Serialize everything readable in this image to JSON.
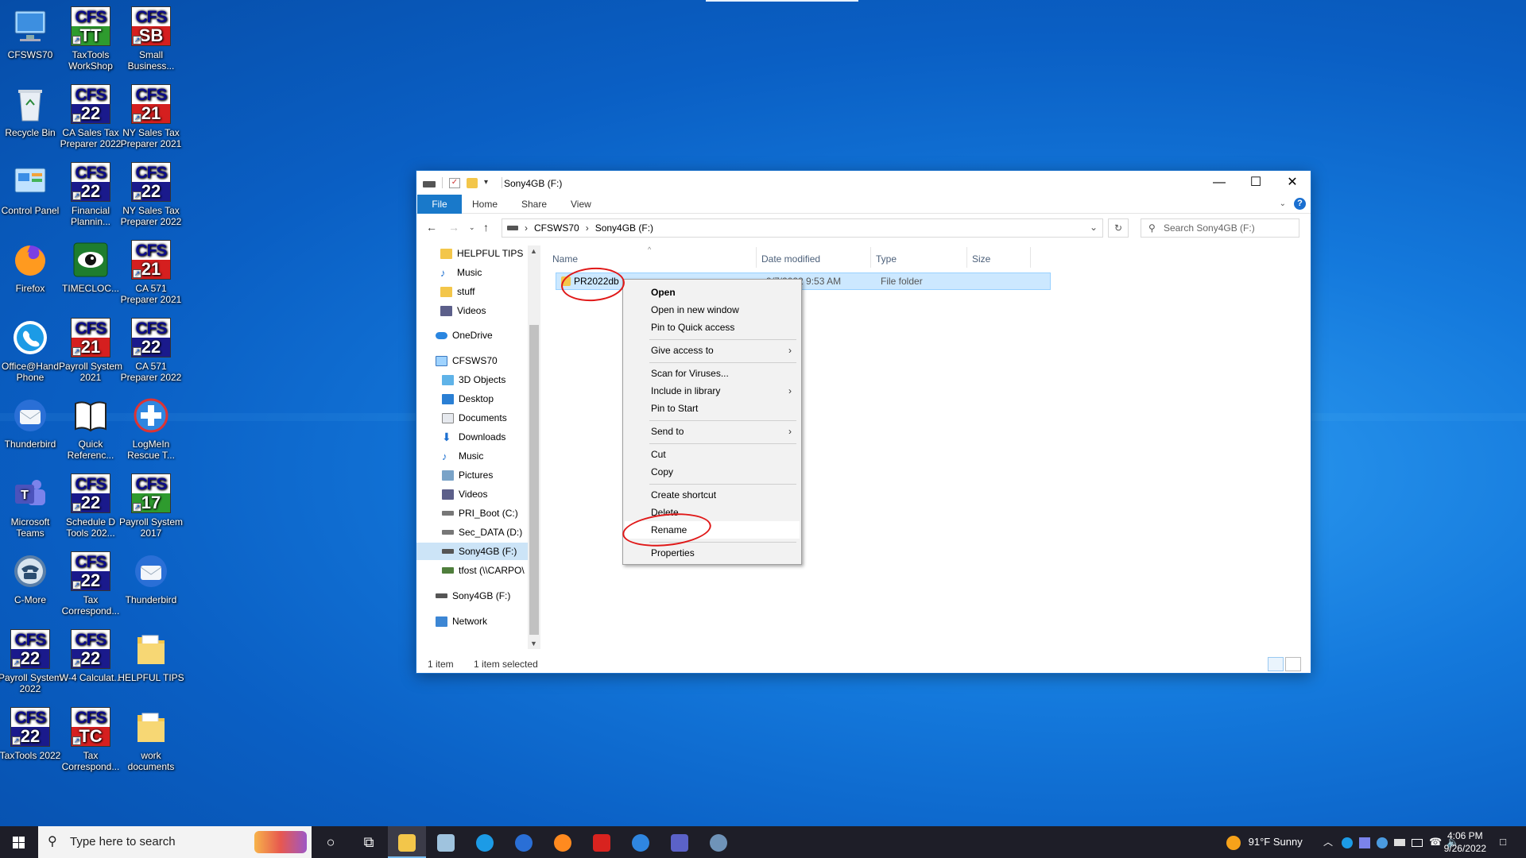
{
  "desktop": {
    "icons": [
      {
        "label": "CFSWS70"
      },
      {
        "label": "TaxTools WorkShop",
        "top": "CFS",
        "bottom": "TT"
      },
      {
        "label": "Small Business...",
        "top": "CFS",
        "bottom": "SB"
      },
      {
        "label": "Recycle Bin"
      },
      {
        "label": "CA Sales Tax Preparer 2022",
        "top": "CFS",
        "bottom": "22"
      },
      {
        "label": "NY Sales Tax Preparer 2021",
        "top": "CFS",
        "bottom": "21"
      },
      {
        "label": "Control Panel"
      },
      {
        "label": "Financial Plannin...",
        "top": "CFS",
        "bottom": "22"
      },
      {
        "label": "NY Sales Tax Preparer 2022",
        "top": "CFS",
        "bottom": "22"
      },
      {
        "label": "Firefox"
      },
      {
        "label": "TIMECLOC..."
      },
      {
        "label": "CA 571 Preparer 2021",
        "top": "CFS",
        "bottom": "21"
      },
      {
        "label": "Office@Hand Phone"
      },
      {
        "label": "Payroll System 2021",
        "top": "CFS",
        "bottom": "21"
      },
      {
        "label": "CA 571 Preparer 2022",
        "top": "CFS",
        "bottom": "22"
      },
      {
        "label": "Thunderbird"
      },
      {
        "label": "Quick Referenc..."
      },
      {
        "label": "LogMeIn Rescue T..."
      },
      {
        "label": "Microsoft Teams"
      },
      {
        "label": "Schedule D Tools 202...",
        "top": "CFS",
        "bottom": "22"
      },
      {
        "label": "Payroll System 2017",
        "top": "CFS",
        "bottom": "17"
      },
      {
        "label": "C-More"
      },
      {
        "label": "Tax Correspond...",
        "top": "CFS",
        "bottom": "22"
      },
      {
        "label": "Thunderbird"
      },
      {
        "label": "Payroll System 2022",
        "top": "CFS",
        "bottom": "22"
      },
      {
        "label": "W-4 Calculat...",
        "top": "CFS",
        "bottom": "22"
      },
      {
        "label": "HELPFUL TIPS"
      },
      {
        "label": "TaxTools 2022",
        "top": "CFS",
        "bottom": "22"
      },
      {
        "label": "Tax Correspond...",
        "top": "CFS",
        "bottom": "TC"
      },
      {
        "label": "work documents"
      }
    ]
  },
  "window": {
    "title": "Sony4GB (F:)",
    "ribbon_tabs": [
      "File",
      "Home",
      "Share",
      "View"
    ],
    "breadcrumb": [
      "CFSWS70",
      "Sony4GB (F:)"
    ],
    "search_placeholder": "Search Sony4GB (F:)",
    "nav": [
      {
        "label": "HELPFUL TIPS",
        "icon": "folder-icon"
      },
      {
        "label": "Music",
        "icon": "music-icon"
      },
      {
        "label": "stuff",
        "icon": "folder-icon"
      },
      {
        "label": "Videos",
        "icon": "videos-icon"
      },
      {
        "label": "OneDrive",
        "icon": "onedrive-icon"
      },
      {
        "label": "CFSWS70",
        "icon": "computer-icon"
      },
      {
        "label": "3D Objects",
        "icon": "3d-objects-icon"
      },
      {
        "label": "Desktop",
        "icon": "desktop-icon"
      },
      {
        "label": "Documents",
        "icon": "documents-icon"
      },
      {
        "label": "Downloads",
        "icon": "downloads-icon"
      },
      {
        "label": "Music",
        "icon": "music-icon"
      },
      {
        "label": "Pictures",
        "icon": "pictures-icon"
      },
      {
        "label": "Videos",
        "icon": "videos-icon"
      },
      {
        "label": "PRI_Boot (C:)",
        "icon": "drive-icon"
      },
      {
        "label": "Sec_DATA (D:)",
        "icon": "drive-icon"
      },
      {
        "label": "Sony4GB (F:)",
        "icon": "usb-drive-icon"
      },
      {
        "label": "tfost (\\\\CARPO\\",
        "icon": "network-drive-icon"
      },
      {
        "label": "Sony4GB (F:)",
        "icon": "usb-drive-icon"
      },
      {
        "label": "Network",
        "icon": "network-icon"
      }
    ],
    "columns": [
      "Name",
      "Date modified",
      "Type",
      "Size"
    ],
    "files": [
      {
        "name": "PR2022db",
        "date": "9/7/2022 9:53 AM",
        "type": "File folder",
        "size": ""
      }
    ],
    "status": {
      "count": "1 item",
      "selected": "1 item selected"
    }
  },
  "context_menu": {
    "items": [
      {
        "label": "Open",
        "bold": true
      },
      {
        "label": "Open in new window"
      },
      {
        "label": "Pin to Quick access"
      },
      {
        "label": "Give access to",
        "submenu": true
      },
      {
        "label": "Scan for Viruses..."
      },
      {
        "label": "Include in library",
        "submenu": true
      },
      {
        "label": "Pin to Start"
      },
      {
        "label": "Send to",
        "submenu": true
      },
      {
        "label": "Cut"
      },
      {
        "label": "Copy"
      },
      {
        "label": "Create shortcut"
      },
      {
        "label": "Delete"
      },
      {
        "label": "Rename"
      },
      {
        "label": "Properties"
      }
    ]
  },
  "taskbar": {
    "search_placeholder": "Type here to search",
    "weather": "91°F  Sunny",
    "time": "4:06 PM",
    "date": "9/26/2022"
  },
  "colors": {
    "accent": "#1979ca",
    "selection": "#cce8ff",
    "annotation": "#e01818",
    "taskbar": "#1e1e28"
  }
}
